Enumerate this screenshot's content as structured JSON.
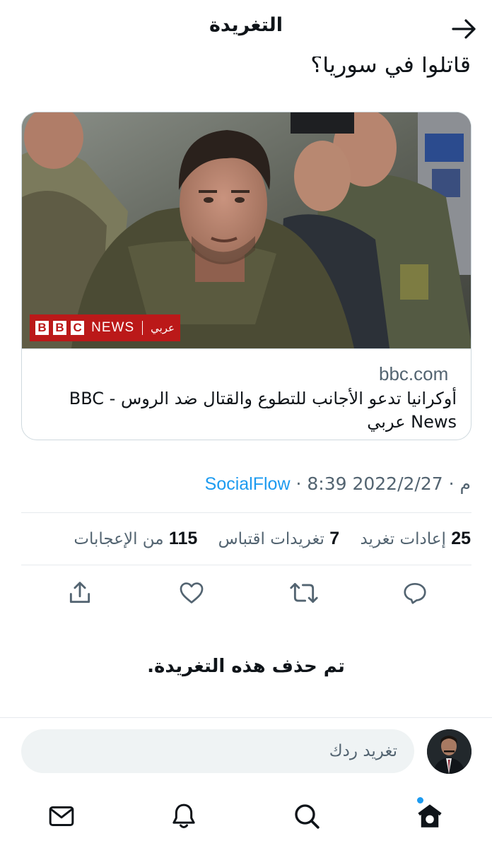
{
  "header": {
    "title": "التغريدة",
    "back_icon": "arrow-right-icon"
  },
  "tweet": {
    "text_tail": "قاتلوا في سوريا؟",
    "card": {
      "domain": "bbc.com",
      "title": "أوكرانيا تدعو الأجانب للتطوع والقتال ضد الروس - BBC News عربي",
      "badge": {
        "b1": "B",
        "b2": "B",
        "b3": "C",
        "news": "NEWS",
        "arabic": "عربي"
      }
    },
    "meta": {
      "time": "8:39 م",
      "date": "2022/2/27",
      "via": "SocialFlow",
      "separator": "·"
    },
    "stats": {
      "retweets_count": "25",
      "retweets_label": "إعادات تغريد",
      "quotes_count": "7",
      "quotes_label": "تغريدات اقتباس",
      "likes_count": "115",
      "likes_label": "من الإعجابات"
    },
    "actions": {
      "reply_icon": "reply-icon",
      "retweet_icon": "retweet-icon",
      "like_icon": "heart-icon",
      "share_icon": "share-icon"
    }
  },
  "deleted_notice": "تم حذف هذه التغريدة.",
  "reply": {
    "placeholder": "تغريد ردك"
  },
  "bottom_nav": {
    "items": [
      "home-icon",
      "search-icon",
      "bell-icon",
      "mail-icon"
    ],
    "accent": "#1d9bf0"
  }
}
